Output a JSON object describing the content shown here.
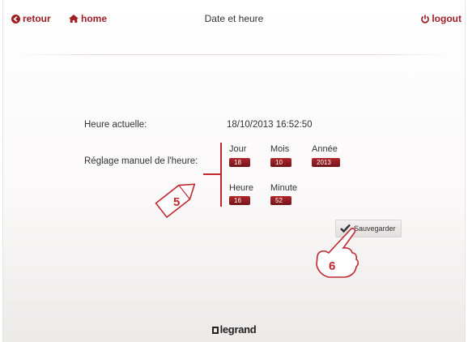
{
  "header": {
    "back_label": "retour",
    "home_label": "home",
    "title": "Date et heure",
    "logout_label": "logout"
  },
  "current_time": {
    "label": "Heure actuelle:",
    "value": "18/10/2013 16:52:50"
  },
  "manual": {
    "label": "Réglage manuel de l'heure:",
    "jour": {
      "label": "Jour",
      "value": "18"
    },
    "mois": {
      "label": "Mois",
      "value": "10"
    },
    "annee": {
      "label": "Année",
      "value": "2013"
    },
    "heure": {
      "label": "Heure",
      "value": "16"
    },
    "minute": {
      "label": "Minute",
      "value": "52"
    }
  },
  "save_label": "Sauvegarder",
  "brand": "legrand",
  "callouts": {
    "field_marker": "5",
    "save_marker": "6"
  },
  "colors": {
    "accent": "#9e1e23",
    "field_bg": "#8c1c21",
    "marker": "#c0282e"
  },
  "icons": [
    "back-arrow-icon",
    "home-icon",
    "power-icon",
    "checkmark-icon",
    "pointing-hand-icon"
  ]
}
